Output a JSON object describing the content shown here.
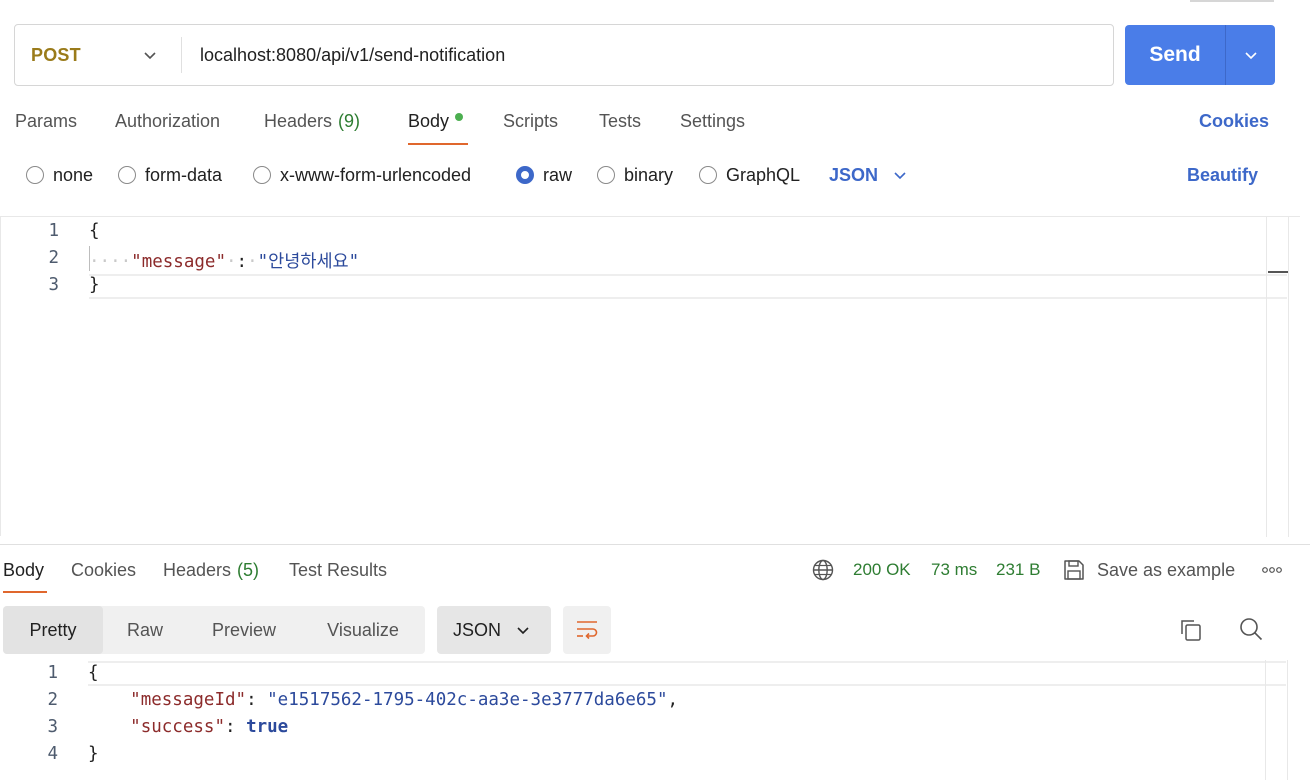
{
  "request": {
    "method": "POST",
    "url": "localhost:8080/api/v1/send-notification",
    "send_label": "Send"
  },
  "request_tabs": {
    "params": "Params",
    "authorization": "Authorization",
    "headers": "Headers",
    "headers_count": "(9)",
    "body": "Body",
    "scripts": "Scripts",
    "tests": "Tests",
    "settings": "Settings",
    "active": "Body"
  },
  "cookies_link": "Cookies",
  "body_types": {
    "none": "none",
    "form_data": "form-data",
    "urlencoded": "x-www-form-urlencoded",
    "raw": "raw",
    "binary": "binary",
    "graphql": "GraphQL",
    "selected": "raw"
  },
  "raw_format": "JSON",
  "beautify_label": "Beautify",
  "request_body": {
    "line_numbers": [
      "1",
      "2",
      "3"
    ],
    "open_brace": "{",
    "key": "\"message\"",
    "colon": ":",
    "value": "\"안녕하세요\"",
    "close_brace": "}"
  },
  "response_tabs": {
    "body": "Body",
    "cookies": "Cookies",
    "headers": "Headers",
    "headers_count": "(5)",
    "test_results": "Test Results",
    "active": "Body"
  },
  "response_meta": {
    "status": "200 OK",
    "time": "73 ms",
    "size": "231 B",
    "save_example": "Save as example"
  },
  "response_views": {
    "pretty": "Pretty",
    "raw": "Raw",
    "preview": "Preview",
    "visualize": "Visualize",
    "active": "Pretty",
    "format": "JSON"
  },
  "response_body": {
    "line_numbers": [
      "1",
      "2",
      "3",
      "4"
    ],
    "open_brace": "{",
    "key1": "\"messageId\"",
    "value1": "\"e1517562-1795-402c-aa3e-3e3777da6e65\"",
    "key2": "\"success\"",
    "value2": "true",
    "close_brace": "}"
  },
  "colors": {
    "accent": "#4a7de8",
    "method": "#9a7b1a",
    "link": "#3d68c9",
    "status_ok": "#2e7d32",
    "tab_underline": "#e0672d"
  },
  "icons": [
    "chevron-down-icon",
    "globe-icon",
    "save-icon",
    "more-icon",
    "wrap-lines-icon",
    "copy-icon",
    "search-icon"
  ]
}
